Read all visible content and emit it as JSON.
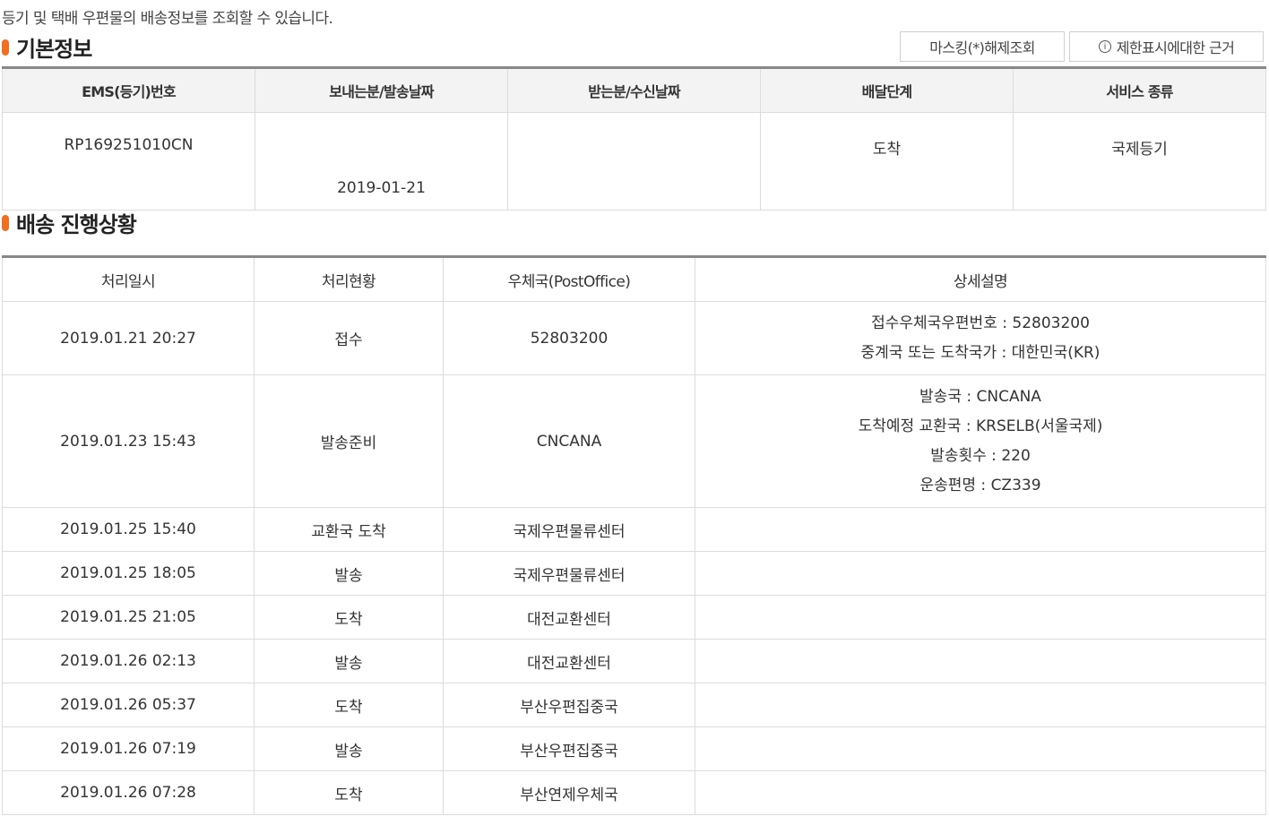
{
  "intro": "등기 및 택배 우편물의 배송정보를 조회할 수 있습니다.",
  "basic_section": {
    "title": "기본정보",
    "buttons": {
      "unmask": "마스킹(*)해제조회",
      "reason": "제한표시에대한 근거",
      "reason_icon": "i"
    },
    "headers": [
      "EMS(등기)번호",
      "보내는분/발송날짜",
      "받는분/수신날짜",
      "배달단계",
      "서비스 종류"
    ],
    "row": {
      "tracking_no": "RP169251010CN",
      "send_date": "2019-01-21",
      "receive": "",
      "stage": "도착",
      "service": "국제등기"
    }
  },
  "progress_section": {
    "title": "배송 진행상황",
    "headers": [
      "처리일시",
      "처리현황",
      "우체국(PostOffice)",
      "상세설명"
    ],
    "rows": [
      {
        "datetime": "2019.01.21 20:27",
        "status": "접수",
        "office": "52803200",
        "details": [
          "접수우체국우편번호 : 52803200",
          "중계국 또는 도착국가 : 대한민국(KR)"
        ]
      },
      {
        "datetime": "2019.01.23 15:43",
        "status": "발송준비",
        "office": "CNCANA",
        "details": [
          "발송국 : CNCANA",
          "도착예정 교환국 : KRSELB(서울국제)",
          "발송횟수 : 220",
          "운송편명 : CZ339"
        ]
      },
      {
        "datetime": "2019.01.25 15:40",
        "status": "교환국 도착",
        "office": "국제우편물류센터",
        "details": []
      },
      {
        "datetime": "2019.01.25 18:05",
        "status": "발송",
        "office": "국제우편물류센터",
        "details": []
      },
      {
        "datetime": "2019.01.25 21:05",
        "status": "도착",
        "office": "대전교환센터",
        "details": []
      },
      {
        "datetime": "2019.01.26 02:13",
        "status": "발송",
        "office": "대전교환센터",
        "details": []
      },
      {
        "datetime": "2019.01.26 05:37",
        "status": "도착",
        "office": "부산우편집중국",
        "details": []
      },
      {
        "datetime": "2019.01.26 07:19",
        "status": "발송",
        "office": "부산우편집중국",
        "details": []
      },
      {
        "datetime": "2019.01.26 07:28",
        "status": "도착",
        "office": "부산연제우체국",
        "details": []
      }
    ]
  },
  "colors": {
    "accent": "#f26f1b",
    "header_bg": "#f3f3f3",
    "border": "#dcdcdc"
  }
}
